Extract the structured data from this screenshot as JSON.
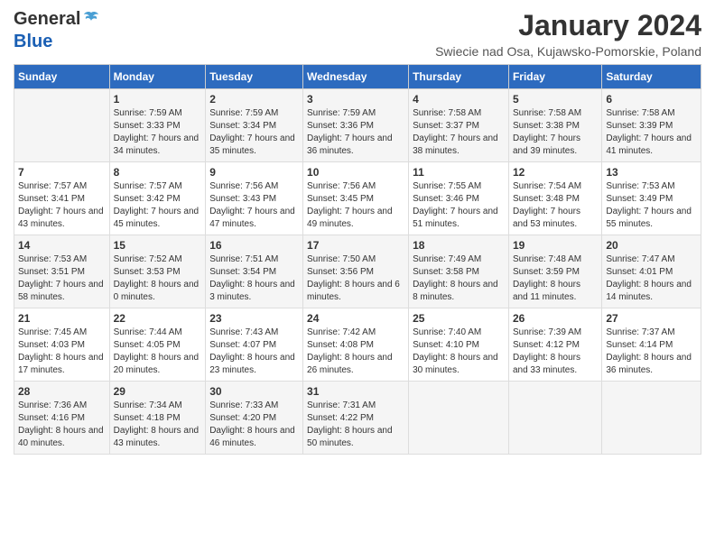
{
  "logo": {
    "general": "General",
    "blue": "Blue"
  },
  "title": "January 2024",
  "subtitle": "Swiecie nad Osa, Kujawsko-Pomorskie, Poland",
  "days_of_week": [
    "Sunday",
    "Monday",
    "Tuesday",
    "Wednesday",
    "Thursday",
    "Friday",
    "Saturday"
  ],
  "weeks": [
    [
      {
        "day": "",
        "sunrise": "",
        "sunset": "",
        "daylight": ""
      },
      {
        "day": "1",
        "sunrise": "Sunrise: 7:59 AM",
        "sunset": "Sunset: 3:33 PM",
        "daylight": "Daylight: 7 hours and 34 minutes."
      },
      {
        "day": "2",
        "sunrise": "Sunrise: 7:59 AM",
        "sunset": "Sunset: 3:34 PM",
        "daylight": "Daylight: 7 hours and 35 minutes."
      },
      {
        "day": "3",
        "sunrise": "Sunrise: 7:59 AM",
        "sunset": "Sunset: 3:36 PM",
        "daylight": "Daylight: 7 hours and 36 minutes."
      },
      {
        "day": "4",
        "sunrise": "Sunrise: 7:58 AM",
        "sunset": "Sunset: 3:37 PM",
        "daylight": "Daylight: 7 hours and 38 minutes."
      },
      {
        "day": "5",
        "sunrise": "Sunrise: 7:58 AM",
        "sunset": "Sunset: 3:38 PM",
        "daylight": "Daylight: 7 hours and 39 minutes."
      },
      {
        "day": "6",
        "sunrise": "Sunrise: 7:58 AM",
        "sunset": "Sunset: 3:39 PM",
        "daylight": "Daylight: 7 hours and 41 minutes."
      }
    ],
    [
      {
        "day": "7",
        "sunrise": "Sunrise: 7:57 AM",
        "sunset": "Sunset: 3:41 PM",
        "daylight": "Daylight: 7 hours and 43 minutes."
      },
      {
        "day": "8",
        "sunrise": "Sunrise: 7:57 AM",
        "sunset": "Sunset: 3:42 PM",
        "daylight": "Daylight: 7 hours and 45 minutes."
      },
      {
        "day": "9",
        "sunrise": "Sunrise: 7:56 AM",
        "sunset": "Sunset: 3:43 PM",
        "daylight": "Daylight: 7 hours and 47 minutes."
      },
      {
        "day": "10",
        "sunrise": "Sunrise: 7:56 AM",
        "sunset": "Sunset: 3:45 PM",
        "daylight": "Daylight: 7 hours and 49 minutes."
      },
      {
        "day": "11",
        "sunrise": "Sunrise: 7:55 AM",
        "sunset": "Sunset: 3:46 PM",
        "daylight": "Daylight: 7 hours and 51 minutes."
      },
      {
        "day": "12",
        "sunrise": "Sunrise: 7:54 AM",
        "sunset": "Sunset: 3:48 PM",
        "daylight": "Daylight: 7 hours and 53 minutes."
      },
      {
        "day": "13",
        "sunrise": "Sunrise: 7:53 AM",
        "sunset": "Sunset: 3:49 PM",
        "daylight": "Daylight: 7 hours and 55 minutes."
      }
    ],
    [
      {
        "day": "14",
        "sunrise": "Sunrise: 7:53 AM",
        "sunset": "Sunset: 3:51 PM",
        "daylight": "Daylight: 7 hours and 58 minutes."
      },
      {
        "day": "15",
        "sunrise": "Sunrise: 7:52 AM",
        "sunset": "Sunset: 3:53 PM",
        "daylight": "Daylight: 8 hours and 0 minutes."
      },
      {
        "day": "16",
        "sunrise": "Sunrise: 7:51 AM",
        "sunset": "Sunset: 3:54 PM",
        "daylight": "Daylight: 8 hours and 3 minutes."
      },
      {
        "day": "17",
        "sunrise": "Sunrise: 7:50 AM",
        "sunset": "Sunset: 3:56 PM",
        "daylight": "Daylight: 8 hours and 6 minutes."
      },
      {
        "day": "18",
        "sunrise": "Sunrise: 7:49 AM",
        "sunset": "Sunset: 3:58 PM",
        "daylight": "Daylight: 8 hours and 8 minutes."
      },
      {
        "day": "19",
        "sunrise": "Sunrise: 7:48 AM",
        "sunset": "Sunset: 3:59 PM",
        "daylight": "Daylight: 8 hours and 11 minutes."
      },
      {
        "day": "20",
        "sunrise": "Sunrise: 7:47 AM",
        "sunset": "Sunset: 4:01 PM",
        "daylight": "Daylight: 8 hours and 14 minutes."
      }
    ],
    [
      {
        "day": "21",
        "sunrise": "Sunrise: 7:45 AM",
        "sunset": "Sunset: 4:03 PM",
        "daylight": "Daylight: 8 hours and 17 minutes."
      },
      {
        "day": "22",
        "sunrise": "Sunrise: 7:44 AM",
        "sunset": "Sunset: 4:05 PM",
        "daylight": "Daylight: 8 hours and 20 minutes."
      },
      {
        "day": "23",
        "sunrise": "Sunrise: 7:43 AM",
        "sunset": "Sunset: 4:07 PM",
        "daylight": "Daylight: 8 hours and 23 minutes."
      },
      {
        "day": "24",
        "sunrise": "Sunrise: 7:42 AM",
        "sunset": "Sunset: 4:08 PM",
        "daylight": "Daylight: 8 hours and 26 minutes."
      },
      {
        "day": "25",
        "sunrise": "Sunrise: 7:40 AM",
        "sunset": "Sunset: 4:10 PM",
        "daylight": "Daylight: 8 hours and 30 minutes."
      },
      {
        "day": "26",
        "sunrise": "Sunrise: 7:39 AM",
        "sunset": "Sunset: 4:12 PM",
        "daylight": "Daylight: 8 hours and 33 minutes."
      },
      {
        "day": "27",
        "sunrise": "Sunrise: 7:37 AM",
        "sunset": "Sunset: 4:14 PM",
        "daylight": "Daylight: 8 hours and 36 minutes."
      }
    ],
    [
      {
        "day": "28",
        "sunrise": "Sunrise: 7:36 AM",
        "sunset": "Sunset: 4:16 PM",
        "daylight": "Daylight: 8 hours and 40 minutes."
      },
      {
        "day": "29",
        "sunrise": "Sunrise: 7:34 AM",
        "sunset": "Sunset: 4:18 PM",
        "daylight": "Daylight: 8 hours and 43 minutes."
      },
      {
        "day": "30",
        "sunrise": "Sunrise: 7:33 AM",
        "sunset": "Sunset: 4:20 PM",
        "daylight": "Daylight: 8 hours and 46 minutes."
      },
      {
        "day": "31",
        "sunrise": "Sunrise: 7:31 AM",
        "sunset": "Sunset: 4:22 PM",
        "daylight": "Daylight: 8 hours and 50 minutes."
      },
      {
        "day": "",
        "sunrise": "",
        "sunset": "",
        "daylight": ""
      },
      {
        "day": "",
        "sunrise": "",
        "sunset": "",
        "daylight": ""
      },
      {
        "day": "",
        "sunrise": "",
        "sunset": "",
        "daylight": ""
      }
    ]
  ]
}
